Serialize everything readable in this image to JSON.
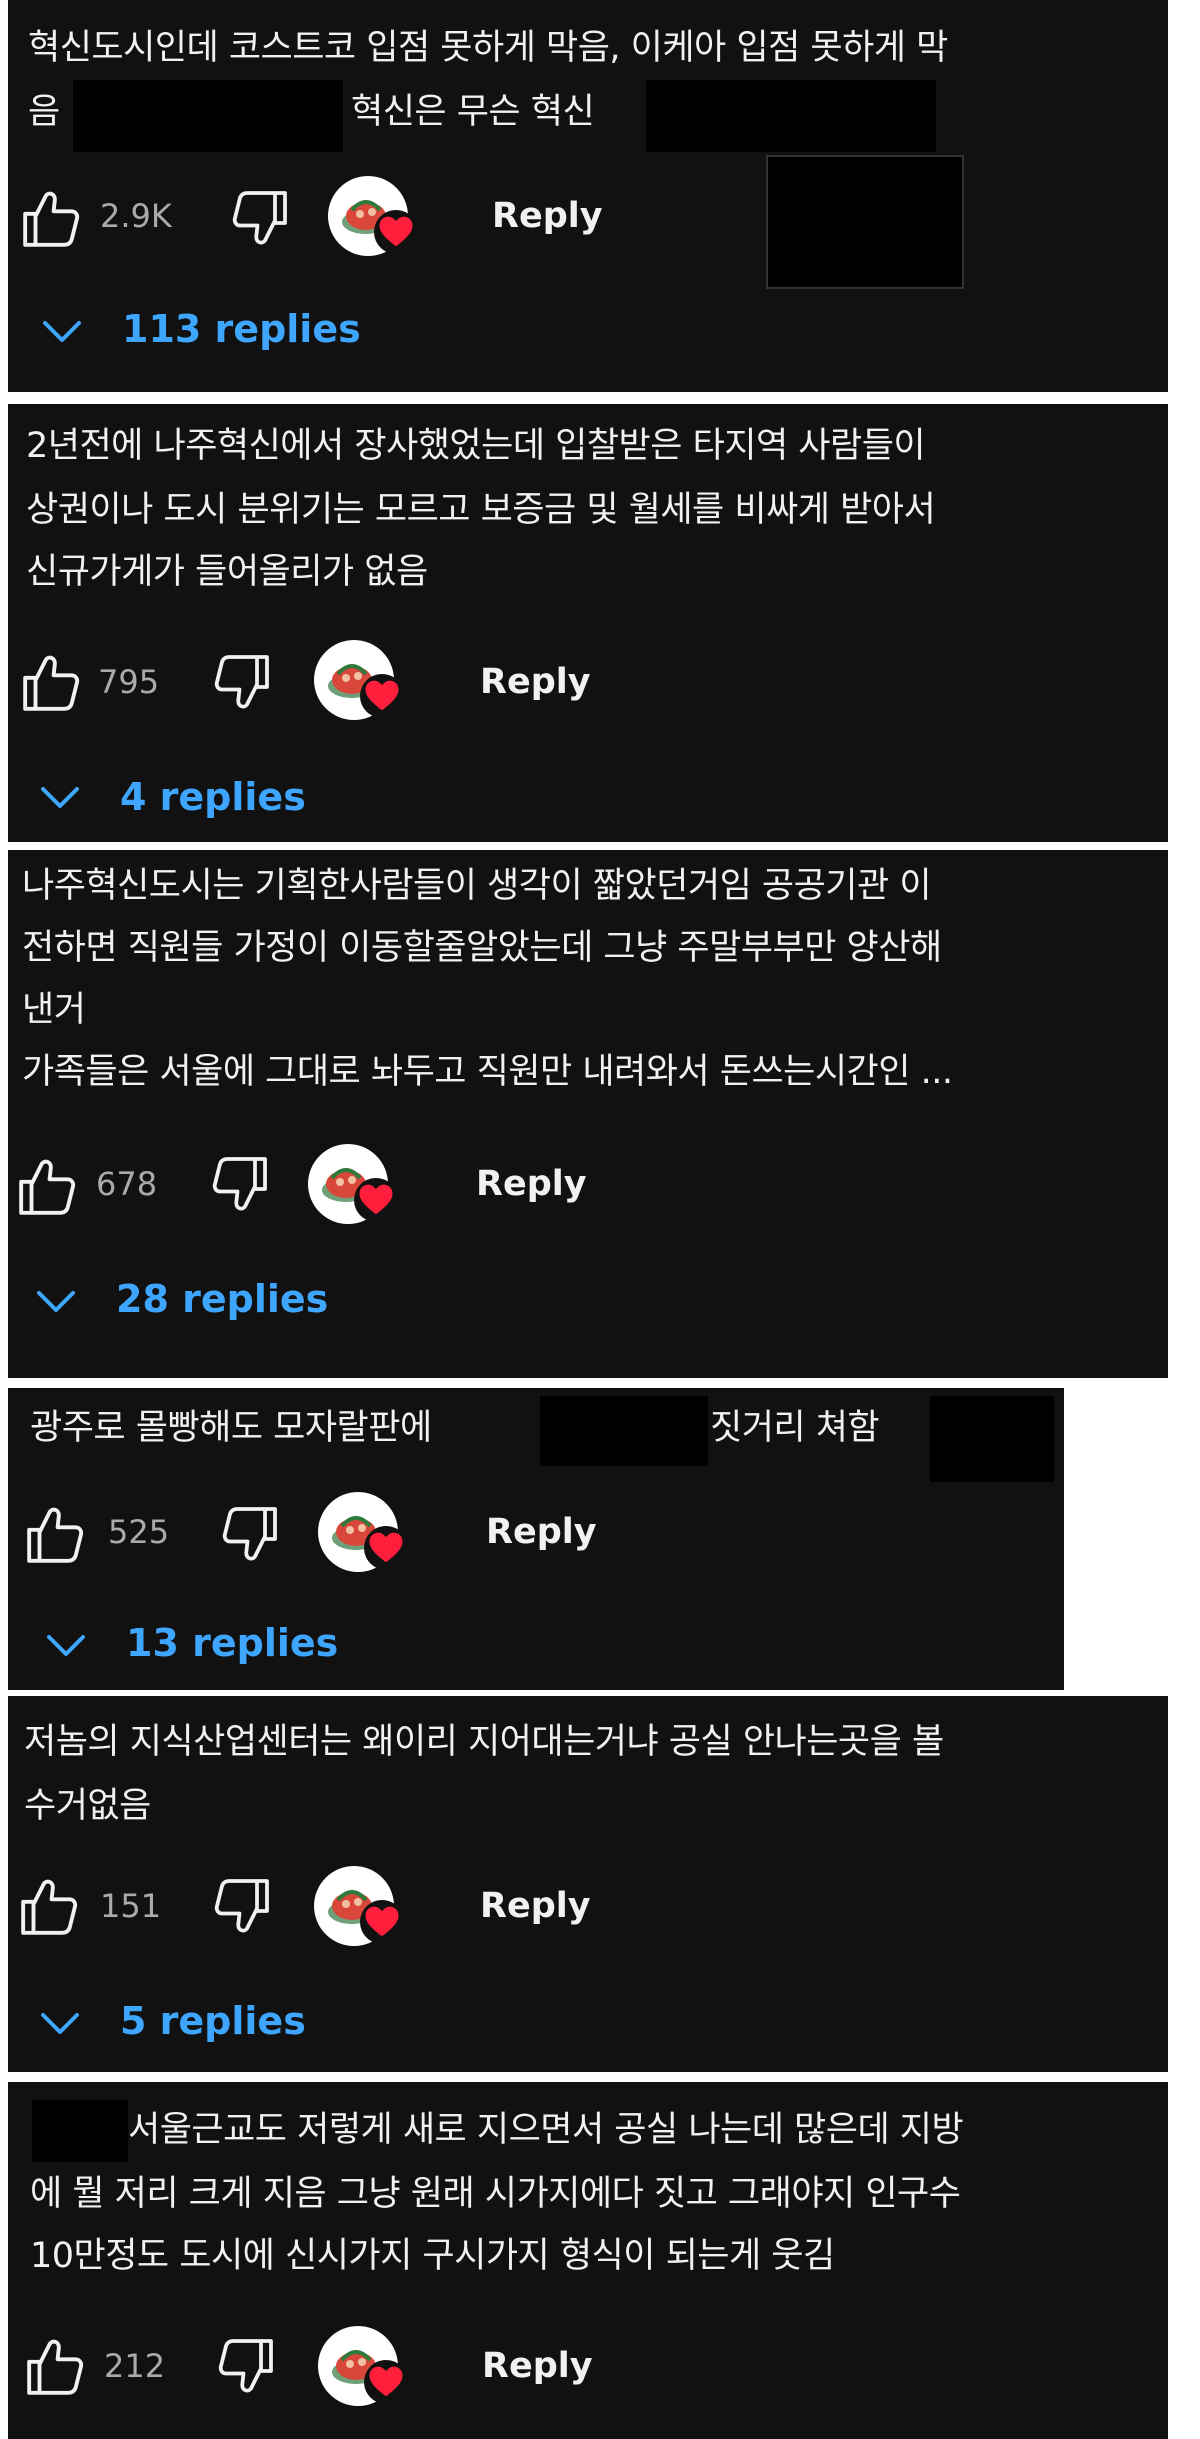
{
  "comments": [
    {
      "lines": [
        "혁신도시인데 코스트코 입점 못하게 막음, 이케아 입점 못하게 막",
        "음",
        "혁신은 무슨 혁신"
      ],
      "likes": "2.9K",
      "reply_label": "Reply",
      "replies_label": "113 replies"
    },
    {
      "lines": [
        "2년전에 나주혁신에서 장사했었는데 입찰받은 타지역 사람들이",
        "상권이나 도시 분위기는 모르고 보증금 및 월세를 비싸게 받아서",
        "신규가게가 들어올리가 없음"
      ],
      "likes": "795",
      "reply_label": "Reply",
      "replies_label": "4 replies"
    },
    {
      "lines": [
        "나주혁신도시는 기획한사람들이 생각이 짧았던거임 공공기관 이",
        "전하면 직원들 가정이 이동할줄알았는데 그냥 주말부부만 양산해",
        "낸거",
        "가족들은 서울에 그대로 놔두고 직원만 내려와서 돈쓰는시간인 ..."
      ],
      "likes": "678",
      "reply_label": "Reply",
      "replies_label": "28 replies"
    },
    {
      "lines": [
        "광주로 몰빵해도 모자랄판에",
        "짓거리 쳐함"
      ],
      "likes": "525",
      "reply_label": "Reply",
      "replies_label": "13 replies"
    },
    {
      "lines": [
        "저놈의 지식산업센터는 왜이리 지어대는거냐 공실 안나는곳을 볼",
        "수거없음"
      ],
      "likes": "151",
      "reply_label": "Reply",
      "replies_label": "5 replies"
    },
    {
      "lines": [
        "서울근교도 저렇게 새로 지으면서 공실 나는데 많은데 지방",
        "에 뭘 저리 크게 지음 그냥 원래 시가지에다 짓고 그래야지 인구수",
        "10만정도 도시에 신시가지 구시가지 형식이 되는게 웃김"
      ],
      "likes": "212",
      "reply_label": "Reply"
    }
  ],
  "colors": {
    "card_bg": "#111111",
    "text": "#f1f1f1",
    "muted": "#aaaaaa",
    "link": "#3ea6ff",
    "heart": "#ff1f3d"
  },
  "icons": [
    "thumbs-up-icon",
    "thumbs-down-icon",
    "creator-heart-icon",
    "chevron-down-icon"
  ]
}
